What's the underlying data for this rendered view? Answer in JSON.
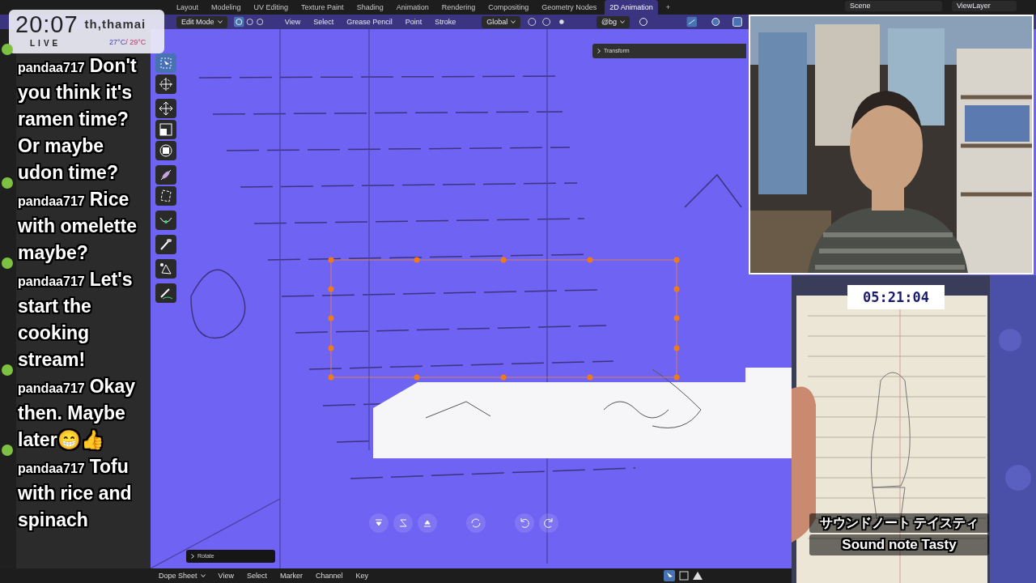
{
  "workspace_tabs": [
    {
      "label": "Layout",
      "selected": false
    },
    {
      "label": "Modeling",
      "selected": false
    },
    {
      "label": "UV Editing",
      "selected": false
    },
    {
      "label": "Texture Paint",
      "selected": false
    },
    {
      "label": "Shading",
      "selected": false
    },
    {
      "label": "Animation",
      "selected": false
    },
    {
      "label": "Rendering",
      "selected": false
    },
    {
      "label": "Compositing",
      "selected": false
    },
    {
      "label": "Geometry Nodes",
      "selected": false
    },
    {
      "label": "2D Animation",
      "selected": true
    }
  ],
  "add_tab": "+",
  "scene": "Scene",
  "view_layer": "ViewLayer",
  "header": {
    "mode": "Edit Mode",
    "menus": [
      "View",
      "Select",
      "Grease Pencil",
      "Point",
      "Stroke"
    ],
    "orientation": "Global",
    "layer": "@bg"
  },
  "toolbar": [
    {
      "kind": "select",
      "selected": true
    },
    {
      "kind": "cursor",
      "selected": false
    },
    {
      "kind": "move",
      "selected": false
    },
    {
      "kind": "scale",
      "selected": false
    },
    {
      "kind": "transform",
      "selected": false
    },
    {
      "kind": "bend",
      "selected": false
    },
    {
      "kind": "shear",
      "selected": false
    },
    {
      "kind": "curve",
      "selected": false
    },
    {
      "kind": "brush",
      "selected": false
    },
    {
      "kind": "interpolate",
      "selected": false
    },
    {
      "kind": "annotate",
      "selected": false
    }
  ],
  "viewport": {
    "panel": "Transform",
    "last_operation": "Rotate"
  },
  "bottom_bar": {
    "editor": "Dope Sheet",
    "menus": [
      "View",
      "Select",
      "Marker",
      "Channel",
      "Key"
    ]
  },
  "clock": {
    "time": "20:07",
    "status": "LIVE",
    "location": "th,thamai",
    "temp_low": "27°C",
    "temp_high": "/ 29°C"
  },
  "chat": [
    {
      "user": "pandaa717",
      "message": "Don't you think it's ramen time? Or maybe udon time?"
    },
    {
      "user": "pandaa717",
      "message": "Rice with omelette maybe?"
    },
    {
      "user": "pandaa717",
      "message": "Let's start the cooking stream!"
    },
    {
      "user": "pandaa717",
      "message": "Okay then. Maybe later😁👍"
    },
    {
      "user": "pandaa717",
      "message": "Tofu with rice and spinach"
    }
  ],
  "timer": "05:21:04",
  "caption_ja": "サウンドノート テイスティ",
  "caption_en": "Sound note Tasty"
}
